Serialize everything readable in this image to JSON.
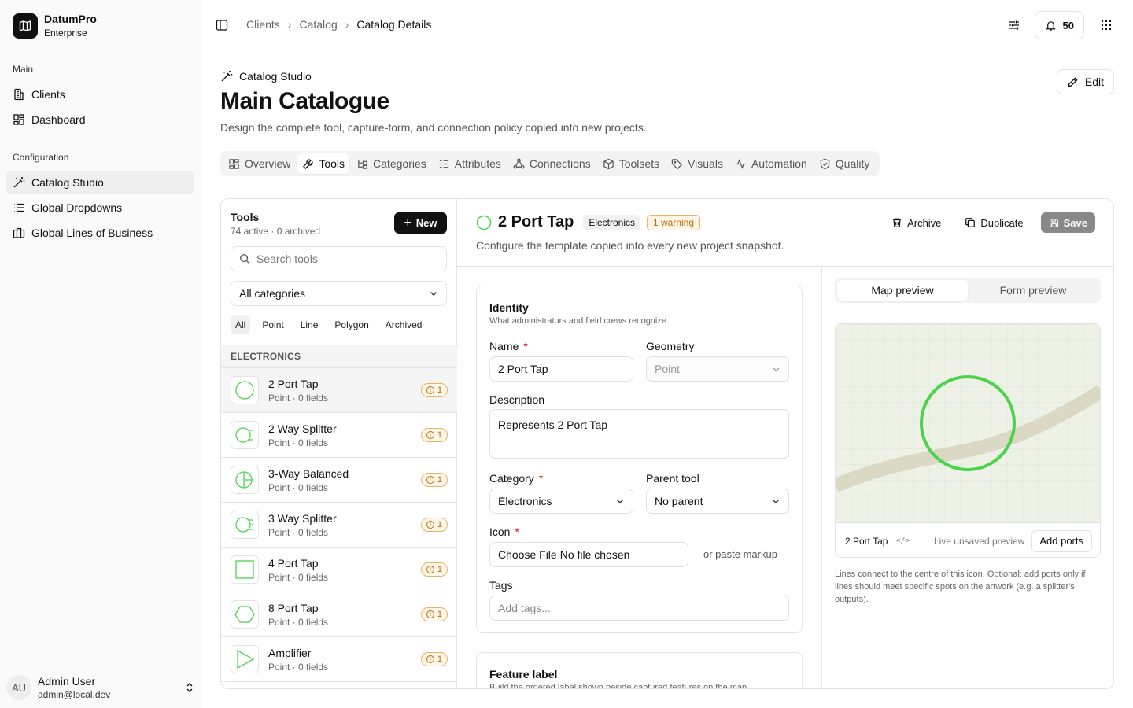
{
  "brand": {
    "name": "DatumPro",
    "plan": "Enterprise",
    "logo_icon": "map-icon"
  },
  "sidebar": {
    "groups": [
      {
        "label": "Main",
        "items": [
          {
            "label": "Clients",
            "icon": "building-icon"
          },
          {
            "label": "Dashboard",
            "icon": "dashboard-icon"
          }
        ]
      },
      {
        "label": "Configuration",
        "items": [
          {
            "label": "Catalog Studio",
            "icon": "wand-icon",
            "active": true
          },
          {
            "label": "Global Dropdowns",
            "icon": "list-icon"
          },
          {
            "label": "Global Lines of Business",
            "icon": "briefcase-icon"
          }
        ]
      }
    ],
    "user": {
      "initials": "AU",
      "name": "Admin User",
      "email": "admin@local.dev"
    }
  },
  "header": {
    "breadcrumbs": [
      "Clients",
      "Catalog",
      "Catalog Details"
    ],
    "notifications": "50"
  },
  "page": {
    "eyebrow": "Catalog Studio",
    "title": "Main Catalogue",
    "description": "Design the complete tool, capture-form, and connection policy copied into new projects.",
    "edit_label": "Edit",
    "tabs": [
      "Overview",
      "Tools",
      "Categories",
      "Attributes",
      "Connections",
      "Toolsets",
      "Visuals",
      "Automation",
      "Quality"
    ],
    "active_tab": "Tools"
  },
  "tools_panel": {
    "title": "Tools",
    "subtitle": "74 active · 0 archived",
    "new_label": "New",
    "search_placeholder": "Search tools",
    "category_filter": "All categories",
    "filters": [
      "All",
      "Point",
      "Line",
      "Polygon",
      "Archived"
    ],
    "active_filter": "All",
    "group": "ELECTRONICS",
    "items": [
      {
        "name": "2 Port Tap",
        "meta": "Point · 0 fields",
        "warnings": "1",
        "shape": "circle"
      },
      {
        "name": "2 Way Splitter",
        "meta": "Point · 0 fields",
        "warnings": "1",
        "shape": "splitter2"
      },
      {
        "name": "3-Way Balanced",
        "meta": "Point · 0 fields",
        "warnings": "1",
        "shape": "balanced3"
      },
      {
        "name": "3 Way Splitter",
        "meta": "Point · 0 fields",
        "warnings": "1",
        "shape": "splitter3"
      },
      {
        "name": "4 Port Tap",
        "meta": "Point · 0 fields",
        "warnings": "1",
        "shape": "square"
      },
      {
        "name": "8 Port Tap",
        "meta": "Point · 0 fields",
        "warnings": "1",
        "shape": "hexagon"
      },
      {
        "name": "Amplifier",
        "meta": "Point · 0 fields",
        "warnings": "1",
        "shape": "triangle"
      }
    ]
  },
  "detail": {
    "title": "2 Port Tap",
    "category_badge": "Electronics",
    "warning_badge": "1 warning",
    "description": "Configure the template copied into every new project snapshot.",
    "actions": {
      "archive": "Archive",
      "duplicate": "Duplicate",
      "save": "Save"
    },
    "identity": {
      "title": "Identity",
      "subtitle": "What administrators and field crews recognize.",
      "name_label": "Name",
      "name_value": "2 Port Tap",
      "geometry_label": "Geometry",
      "geometry_value": "Point",
      "description_label": "Description",
      "description_value": "Represents 2 Port Tap",
      "category_label": "Category",
      "category_value": "Electronics",
      "parent_label": "Parent tool",
      "parent_value": "No parent",
      "icon_label": "Icon",
      "file_button": "Choose File",
      "file_status": "No file chosen",
      "paste_markup": "or paste markup",
      "tags_label": "Tags",
      "tags_placeholder": "Add tags..."
    },
    "feature_label": {
      "title": "Feature label",
      "subtitle": "Build the ordered label shown beside captured features on the map."
    },
    "preview": {
      "tabs": [
        "Map preview",
        "Form preview"
      ],
      "active": "Map preview",
      "footer_name": "2 Port Tap",
      "footer_code": "</>",
      "live_text": "Live unsaved preview",
      "add_ports": "Add ports",
      "note": "Lines connect to the centre of this icon. Optional: add ports only if lines should meet specific spots on the artwork (e.g. a splitter's outputs).",
      "symbol_color": "#4cd34c"
    }
  }
}
